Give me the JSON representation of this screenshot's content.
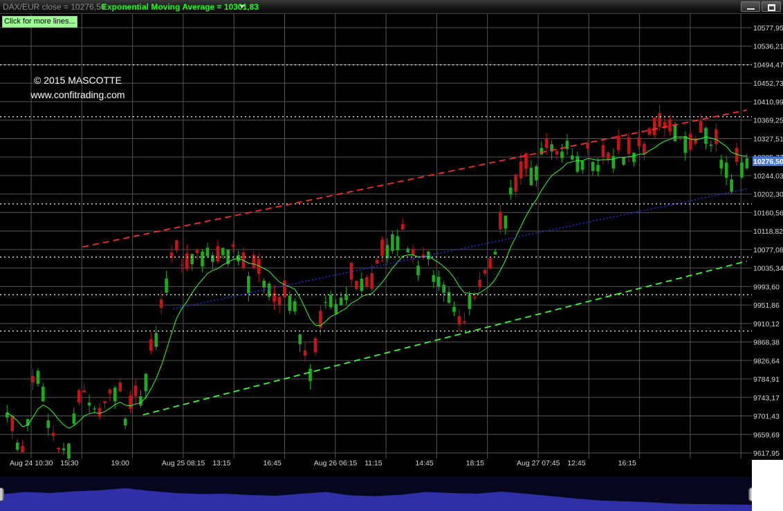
{
  "header": {
    "series_label": "DAX/EUR close = 10276,50",
    "ema_label": "Exponential Moving Average = 10301,83",
    "more_lines_label": "Click for more lines..."
  },
  "watermark": {
    "line1": "© 2015 MASCOTTE",
    "line2": "www.confitrading.com"
  },
  "colors": {
    "background": "#000000",
    "grid": "#555555",
    "candle_up": "#1faa1f",
    "candle_down": "#c41414",
    "ema": "#33ff33",
    "upper_channel": "#ff2b2b",
    "lower_channel": "#33ff33",
    "mid_trend": "#2a2aff",
    "level_lines": "#d8d8d8",
    "last_price_bg": "#4a7ad6"
  },
  "chart_data": {
    "type": "candlestick",
    "symbol": "DAX/EUR",
    "last_close": 10276.5,
    "last_ema": 10301.83,
    "ylim": [
      9600,
      10600
    ],
    "y_ticks": [
      "10577,95",
      "10536,21",
      "10494,47",
      "10452,73",
      "10410,99",
      "10369,25",
      "10327,51",
      "10285,77",
      "10244,03",
      "10202,30",
      "10160,56",
      "10118,82",
      "10077,08",
      "10035,34",
      "9993,60",
      "9951,86",
      "9910,12",
      "9868,38",
      "9826,64",
      "9784,91",
      "9743,17",
      "9701,43",
      "9659,69",
      "9617,95"
    ],
    "x_ticks": [
      "Aug 24 10:30",
      "15:30",
      "19:00",
      "Aug 25 08:15",
      "13:15",
      "16:45",
      "Aug 26 06:15",
      "11:15",
      "14:45",
      "18:15",
      "Aug 27 07:45",
      "12:45",
      "16:15"
    ],
    "last_price_label": "10276,50",
    "horizontal_levels": [
      10494,
      10377,
      10180,
      10060,
      9975,
      9893
    ],
    "trend_lines": [
      {
        "name": "upper-channel",
        "points": [
          [
            5,
            10083
          ],
          [
            49,
            10392
          ]
        ]
      },
      {
        "name": "mid-trend",
        "points": [
          [
            11,
            9943
          ],
          [
            49,
            10214
          ]
        ]
      },
      {
        "name": "lower-channel",
        "points": [
          [
            9,
            9704
          ],
          [
            49,
            10051
          ]
        ]
      }
    ],
    "anchors": [
      [
        9722,
        9696
      ],
      [
        9616,
        9644
      ],
      [
        9822,
        9896
      ],
      [
        9638,
        9676
      ],
      [
        9650,
        9745
      ],
      [
        9762,
        9712
      ],
      [
        9682,
        9644
      ],
      [
        9785,
        9770
      ],
      [
        9690,
        9678
      ],
      [
        9775,
        9768
      ],
      [
        9921,
        9946
      ],
      [
        10064,
        10086
      ],
      [
        10035,
        10020
      ],
      [
        10098,
        10071
      ],
      [
        10066,
        10079
      ],
      [
        10106,
        10101
      ],
      [
        10024,
        10012
      ],
      [
        9998,
        9980
      ],
      [
        9964,
        9974
      ],
      [
        9973,
        9946
      ],
      [
        9802,
        9813
      ],
      [
        9958,
        9969
      ],
      [
        9968,
        9981
      ],
      [
        9992,
        9983
      ],
      [
        9993,
        9964
      ],
      [
        10072,
        10082
      ],
      [
        10117,
        10120
      ],
      [
        10066,
        10080
      ],
      [
        10049,
        10046
      ],
      [
        9997,
        9987
      ],
      [
        9916,
        9923
      ],
      [
        9976,
        9974
      ],
      [
        10028,
        10026
      ],
      [
        10168,
        10159
      ],
      [
        10257,
        10240
      ],
      [
        10279,
        10286
      ],
      [
        10320,
        10332
      ],
      [
        10305,
        10311
      ],
      [
        10288,
        10283
      ],
      [
        10276,
        10275
      ],
      [
        10274,
        10286
      ],
      [
        10313,
        10300
      ],
      [
        10310,
        10306
      ],
      [
        10333,
        10323
      ],
      [
        10354,
        10330
      ],
      [
        10318,
        10331
      ],
      [
        10344,
        10340
      ],
      [
        10305,
        10338
      ],
      [
        10248,
        10325
      ],
      [
        10277,
        10304
      ]
    ],
    "candle_count": 145,
    "navigator_levels": [
      0.48,
      0.55,
      0.52,
      0.57,
      0.6,
      0.66,
      0.58,
      0.52,
      0.49,
      0.5,
      0.46,
      0.44,
      0.5,
      0.55,
      0.45,
      0.43,
      0.47,
      0.55,
      0.52,
      0.5,
      0.56,
      0.5,
      0.43,
      0.36,
      0.3,
      0.28,
      0.25,
      0.21,
      0.2,
      0.19,
      0.18
    ]
  }
}
